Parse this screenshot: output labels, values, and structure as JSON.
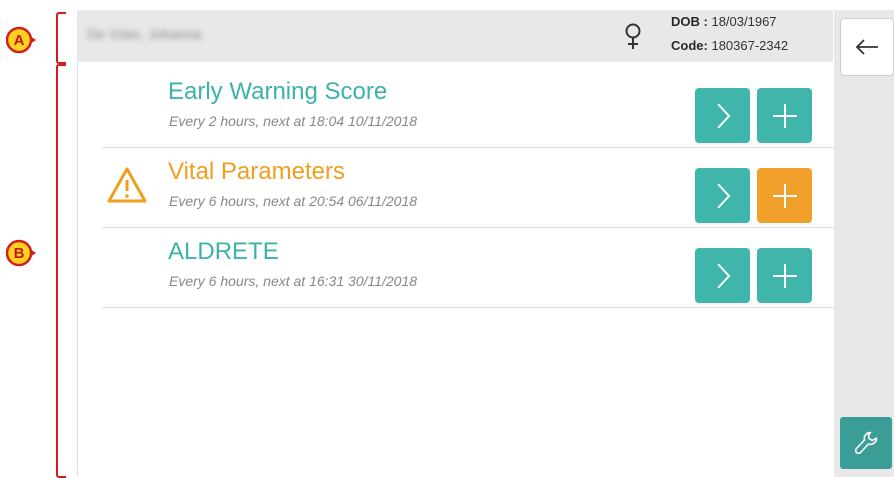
{
  "header": {
    "patient_name": "De Vries, Johanna",
    "gender_icon": "female-icon",
    "dob_label": "DOB :",
    "dob_value": "18/03/1967",
    "code_label": "Code:",
    "code_value": "180367-2342"
  },
  "rows": [
    {
      "title": "Early Warning Score",
      "subtitle": "Every 2 hours, next at 18:04 10/11/2018",
      "warning": false
    },
    {
      "title": "Vital Parameters",
      "subtitle": "Every 6 hours, next at 20:54 06/11/2018",
      "warning": true
    },
    {
      "title": "ALDRETE",
      "subtitle": "Every 6  hours, next at 16:31 30/11/2018",
      "warning": false
    }
  ],
  "sidebar": {
    "back_icon": "arrow-left-icon",
    "tools_icon": "wrench-icon"
  },
  "callouts": {
    "a": "A",
    "b": "B"
  },
  "colors": {
    "teal": "#3fb5ab",
    "orange": "#f0a02a",
    "callout_red": "#d21e1e",
    "callout_yellow": "#ffd21f"
  }
}
